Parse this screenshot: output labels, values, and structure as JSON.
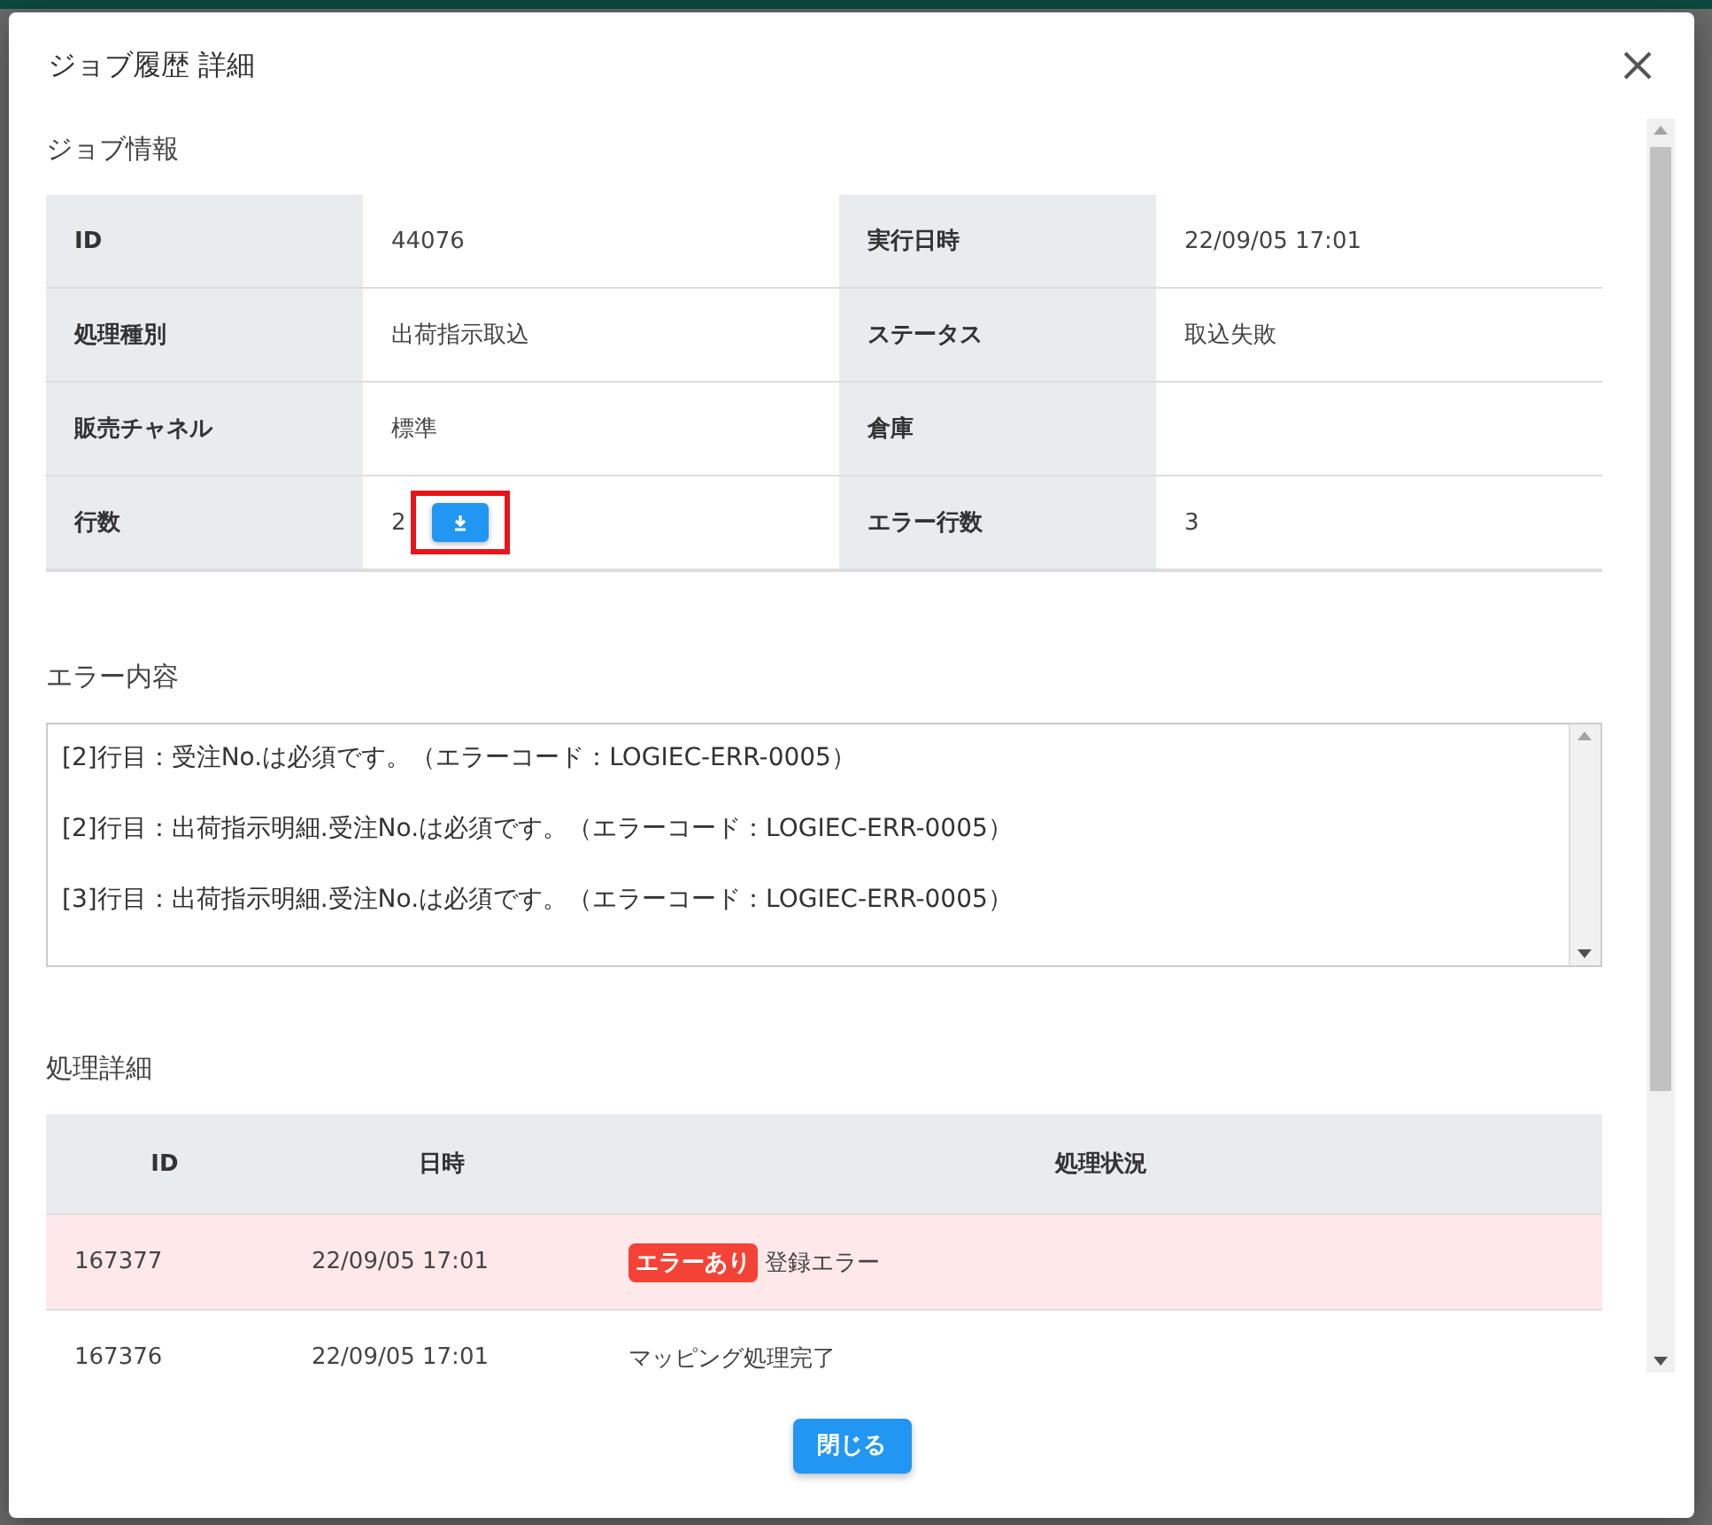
{
  "dialog": {
    "title": "ジョブ履歴 詳細"
  },
  "job_info": {
    "heading": "ジョブ情報",
    "rows": [
      {
        "cells": [
          {
            "label": "ID",
            "value": "44076"
          },
          {
            "label": "実行日時",
            "value": "22/09/05 17:01"
          }
        ]
      },
      {
        "cells": [
          {
            "label": "処理種別",
            "value": "出荷指示取込"
          },
          {
            "label": "ステータス",
            "value": "取込失敗"
          }
        ]
      },
      {
        "cells": [
          {
            "label": "販売チャネル",
            "value": "標準"
          },
          {
            "label": "倉庫"
          }
        ]
      },
      {
        "cells": [
          {
            "label": "行数",
            "value": "2",
            "download": true
          },
          {
            "label": "エラー行数",
            "value": "3"
          }
        ]
      }
    ]
  },
  "errors": {
    "heading": "エラー内容",
    "lines": [
      "[2]行目：受注No.は必須です。（エラーコード：LOGIEC-ERR-0005）",
      "[2]行目：出荷指示明細.受注No.は必須です。（エラーコード：LOGIEC-ERR-0005）",
      "[3]行目：出荷指示明細.受注No.は必須です。（エラーコード：LOGIEC-ERR-0005）"
    ]
  },
  "details": {
    "heading": "処理詳細",
    "columns": [
      "ID",
      "日時",
      "処理状況"
    ],
    "rows": [
      {
        "id": "167377",
        "time": "22/09/05 17:01",
        "badge": "エラーあり",
        "status": "登録エラー",
        "error": true
      },
      {
        "id": "167376",
        "time": "22/09/05 17:01",
        "status": "マッピング処理完了",
        "error": false
      }
    ]
  },
  "close_button": "閉じる"
}
